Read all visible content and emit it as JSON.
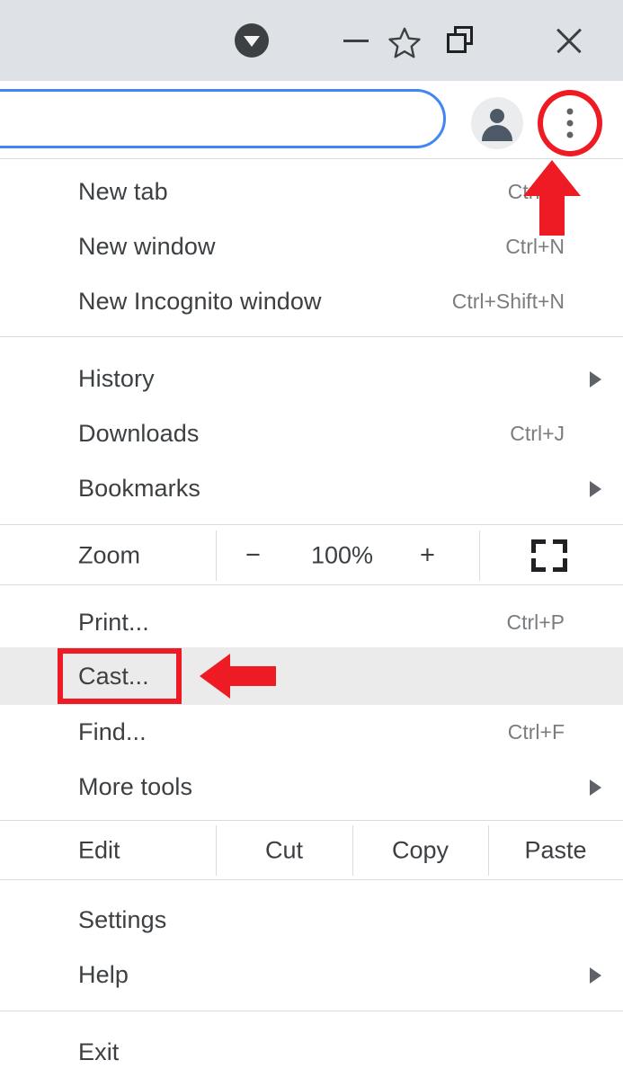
{
  "window": {
    "controls": [
      {
        "name": "download-indicator",
        "icon": "download-arrow-circle-icon",
        "label": ""
      },
      {
        "name": "minimize",
        "icon": "minimize-icon",
        "label": ""
      },
      {
        "name": "restore",
        "icon": "restore-window-icon",
        "label": ""
      },
      {
        "name": "close",
        "icon": "close-icon",
        "label": ""
      }
    ]
  },
  "toolbar": {
    "omnibox_value": "",
    "omnibox_placeholder": "",
    "bookmark_icon": "star-icon",
    "profile_icon": "account-avatar-icon",
    "menu_icon": "three-dot-menu-icon",
    "highlight_color": "#ee1b24",
    "focus_color": "#4285f4"
  },
  "menu": {
    "groups": [
      {
        "items": [
          {
            "label": "New tab",
            "accel": "Ctrl+T",
            "submenu": false
          },
          {
            "label": "New window",
            "accel": "Ctrl+N",
            "submenu": false
          },
          {
            "label": "New Incognito window",
            "accel": "Ctrl+Shift+N",
            "submenu": false
          }
        ]
      },
      {
        "items": [
          {
            "label": "History",
            "accel": "",
            "submenu": true
          },
          {
            "label": "Downloads",
            "accel": "Ctrl+J",
            "submenu": false
          },
          {
            "label": "Bookmarks",
            "accel": "",
            "submenu": true
          }
        ]
      }
    ],
    "zoom_row": {
      "label": "Zoom",
      "decrease": "−",
      "level": "100%",
      "increase": "+",
      "fullscreen_icon": "fullscreen-icon"
    },
    "group3": {
      "items": [
        {
          "label": "Print...",
          "accel": "Ctrl+P",
          "submenu": false
        },
        {
          "label": "Cast...",
          "accel": "",
          "submenu": false,
          "highlighted": true
        },
        {
          "label": "Find...",
          "accel": "Ctrl+F",
          "submenu": false
        },
        {
          "label": "More tools",
          "accel": "",
          "submenu": true
        }
      ]
    },
    "edit_row": {
      "label": "Edit",
      "cut": "Cut",
      "copy": "Copy",
      "paste": "Paste"
    },
    "group4": {
      "items": [
        {
          "label": "Settings",
          "accel": "",
          "submenu": false
        },
        {
          "label": "Help",
          "accel": "",
          "submenu": true
        }
      ]
    },
    "group5": {
      "items": [
        {
          "label": "Exit",
          "accel": "",
          "submenu": false
        }
      ]
    }
  },
  "annotations": {
    "color": "#ee1b24",
    "menu_button_circle": "circle-highlight-three-dot-menu",
    "cast_box": "rectangle-highlight-cast",
    "arrow_to_cast": "left-arrow-pointing-to-cast",
    "arrow_to_menu": "up-arrow-pointing-to-menu-button"
  }
}
